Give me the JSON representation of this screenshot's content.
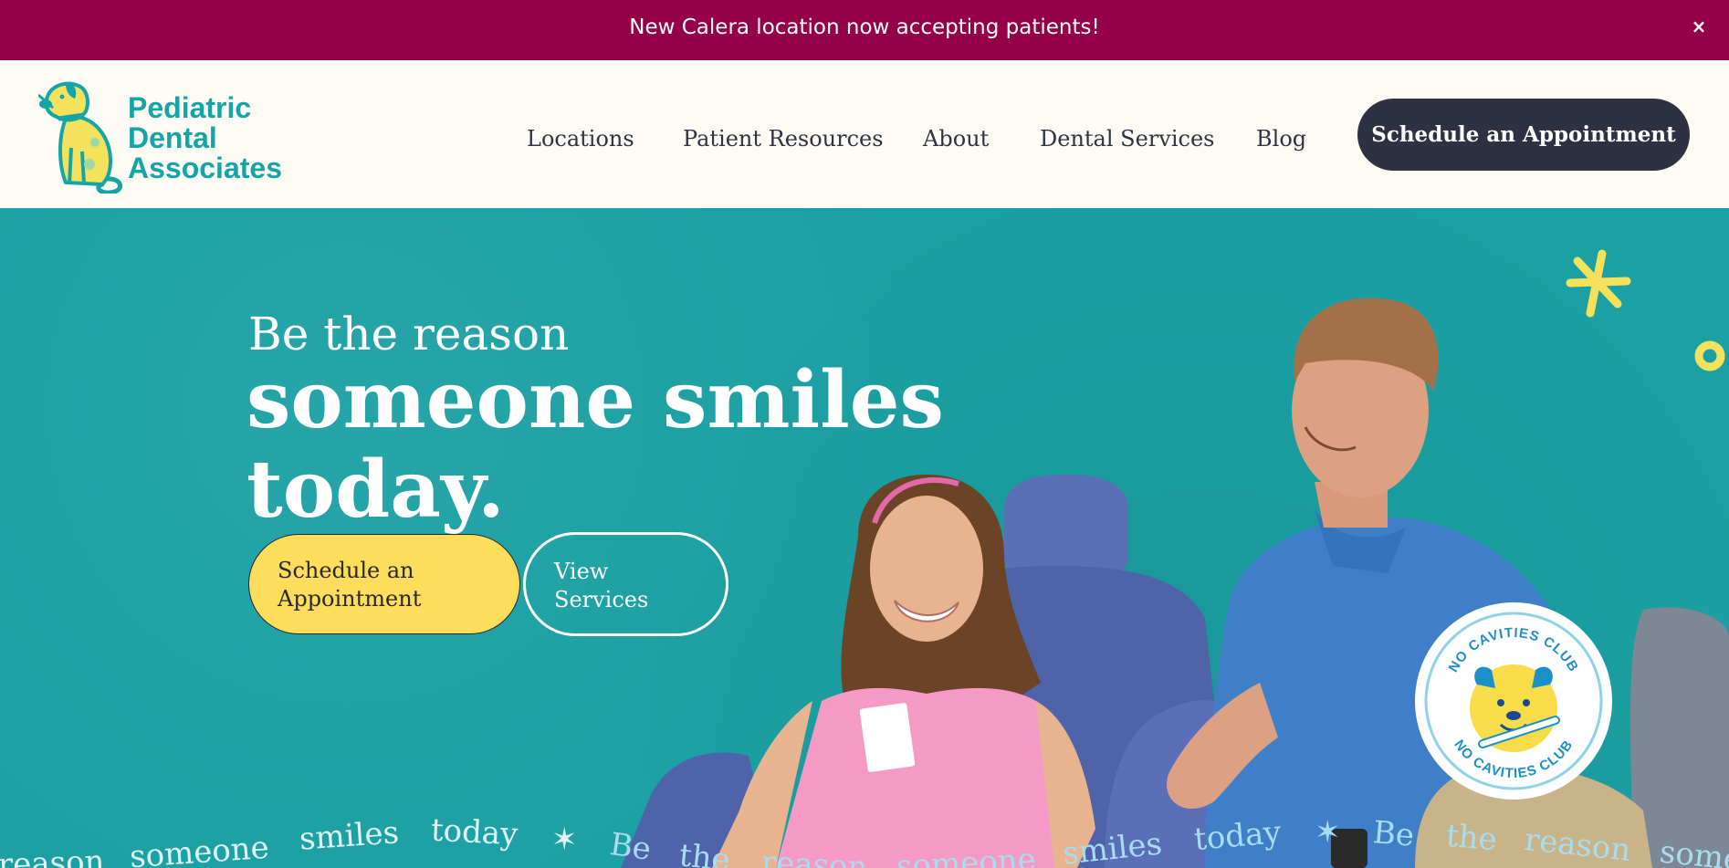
{
  "announcement": {
    "text": "New Calera location now accepting patients!",
    "close_label": "×"
  },
  "header": {
    "logo": {
      "line1": "Pediatric",
      "line2": "Dental",
      "line3": "Associates"
    },
    "nav": [
      {
        "label": "Locations"
      },
      {
        "label": "Patient Resources"
      },
      {
        "label": "About"
      },
      {
        "label": "Dental Services"
      },
      {
        "label": "Blog"
      }
    ],
    "cta_label": "Schedule an Appointment"
  },
  "hero": {
    "eyebrow": "Be the reason",
    "headline_line1": "someone smiles",
    "headline_line2": "today.",
    "primary_button": {
      "line1": "Schedule an",
      "line2": "Appointment"
    },
    "secondary_button": {
      "line1": "View",
      "line2": "Services"
    },
    "marquee": [
      "reason",
      "someone",
      "smiles",
      "today",
      "✶",
      "Be",
      "the",
      "reason",
      "someone",
      "smiles",
      "today",
      "✶",
      "Be",
      "the",
      "reason",
      "some"
    ],
    "badge_text": "NO CAVITIES CLUB"
  },
  "colors": {
    "announcement_bg": "#94004a",
    "brand_teal": "#15a5a7",
    "hero_bg": "#1ba0a3",
    "cta_dark": "#2d3142",
    "button_yellow": "#ffdd5c"
  }
}
